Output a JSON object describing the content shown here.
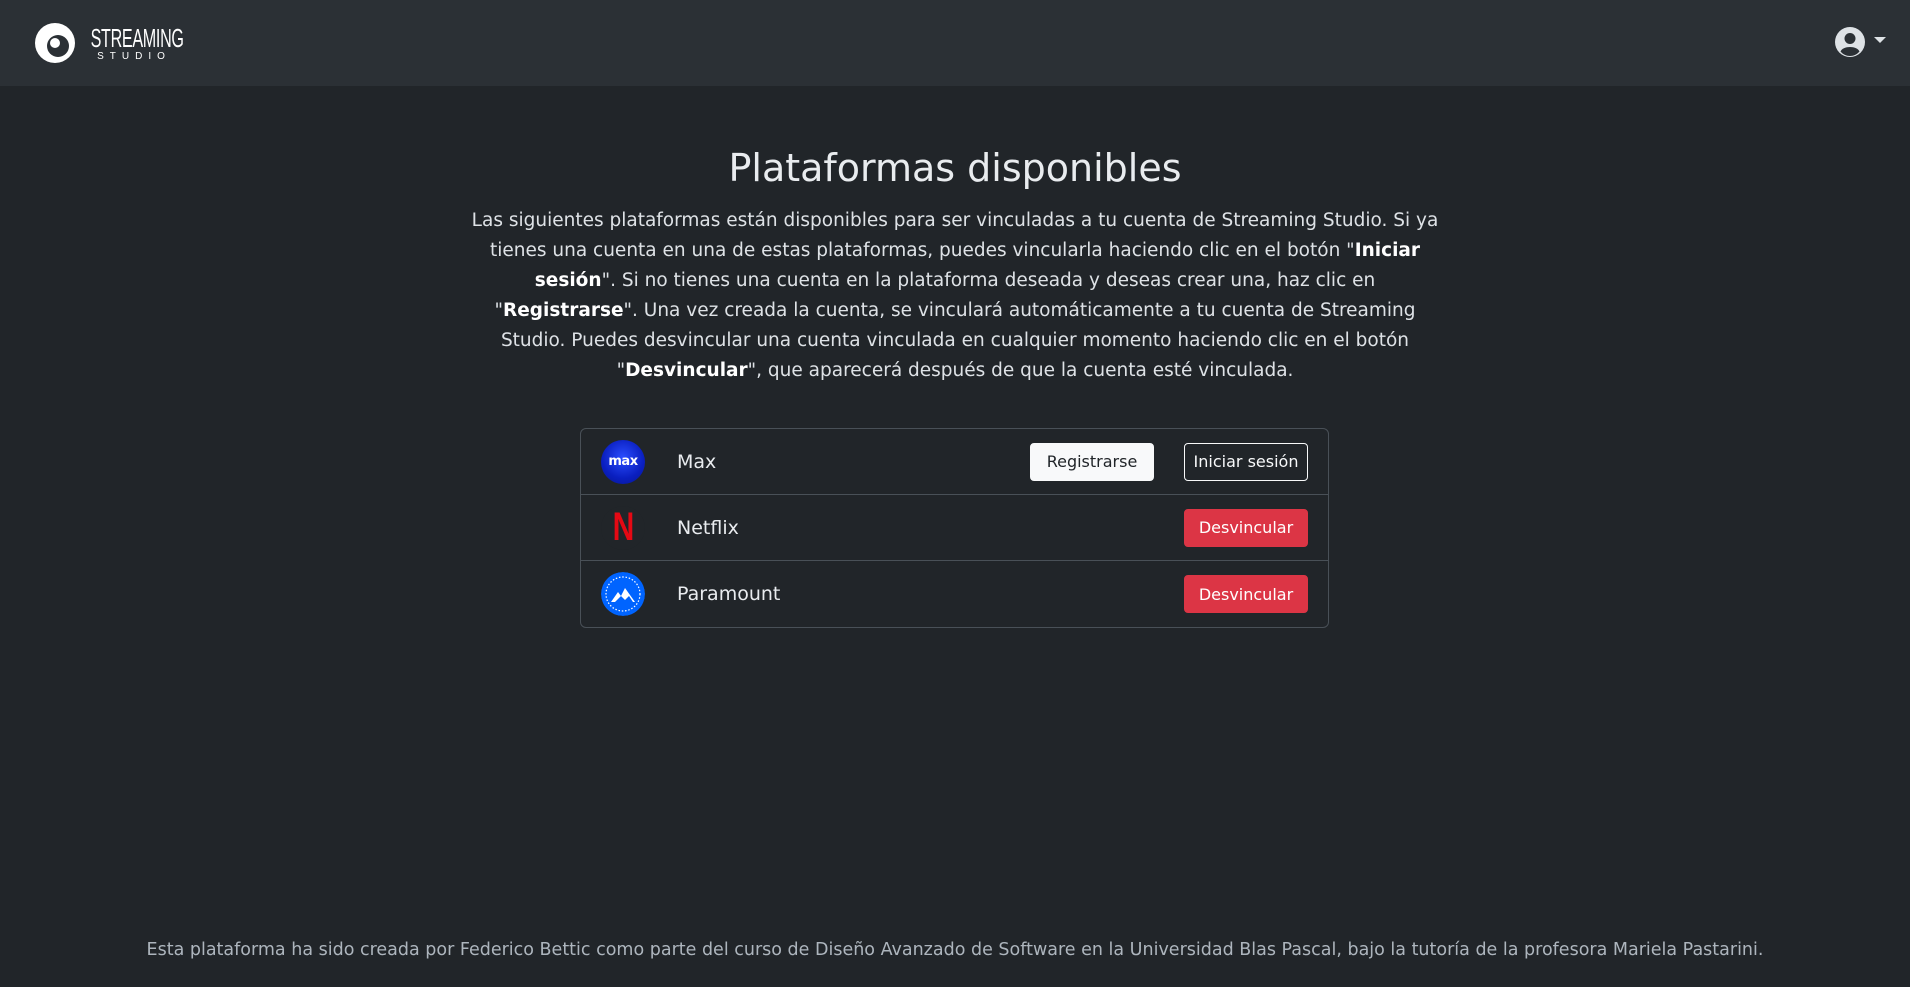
{
  "header": {
    "logo_main": "STREAMING",
    "logo_sub": "STUDIO",
    "user_icon": "user-circle-icon"
  },
  "main": {
    "title": "Plataformas disponibles",
    "description": {
      "part1": "Las siguientes plataformas están disponibles para ser vinculadas a tu cuenta de Streaming Studio. Si ya tienes una cuenta en una de estas plataformas, puedes vincularla haciendo clic en el botón \"",
      "bold1": "Iniciar sesión",
      "part2": "\". Si no tienes una cuenta en la plataforma deseada y deseas crear una, haz clic en \"",
      "bold2": "Registrarse",
      "part3": "\". Una vez creada la cuenta, se vinculará automáticamente a tu cuenta de Streaming Studio. Puedes desvincular una cuenta vinculada en cualquier momento haciendo clic en el botón \"",
      "bold3": "Desvincular",
      "part4": "\", que aparecerá después de que la cuenta esté vinculada."
    },
    "platforms": [
      {
        "name": "Max",
        "logo_text": "max",
        "register_label": "Registrarse",
        "login_label": "Iniciar sesión",
        "color": "#0a2fd6"
      },
      {
        "name": "Netflix",
        "logo_text": "N",
        "unlink_label": "Desvincular",
        "color": "#e50914"
      },
      {
        "name": "Paramount",
        "logo_text": "",
        "unlink_label": "Desvincular",
        "color": "#0064ff"
      }
    ]
  },
  "footer": {
    "text": "Esta plataforma ha sido creada por Federico Bettic como parte del curso de Diseño Avanzado de Software en la Universidad Blas Pascal, bajo la tutoría de la profesora Mariela Pastarini."
  },
  "colors": {
    "background": "#212529",
    "navbar": "#2b3035",
    "danger": "#dc3545",
    "border": "#495057"
  }
}
